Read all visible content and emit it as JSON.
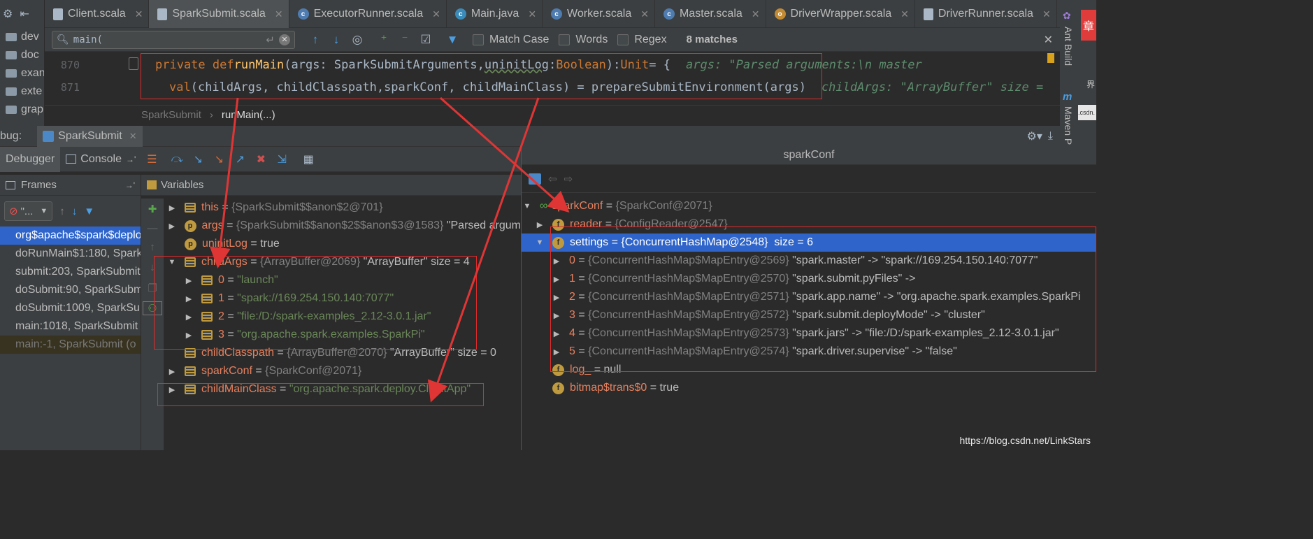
{
  "project": {
    "items": [
      {
        "label": "dev"
      },
      {
        "label": "doc"
      },
      {
        "label": "exan"
      },
      {
        "label": "exte"
      },
      {
        "label": "grap"
      }
    ]
  },
  "tabs": [
    {
      "label": "Client.scala",
      "icon": "scala-file-icon"
    },
    {
      "label": "SparkSubmit.scala",
      "icon": "scala-file-icon"
    },
    {
      "label": "ExecutorRunner.scala",
      "icon": "scala-class-icon"
    },
    {
      "label": "Main.java",
      "icon": "java-class-icon"
    },
    {
      "label": "Worker.scala",
      "icon": "scala-class-icon"
    },
    {
      "label": "Master.scala",
      "icon": "scala-class-icon"
    },
    {
      "label": "DriverWrapper.scala",
      "icon": "scala-object-icon"
    },
    {
      "label": "DriverRunner.scala",
      "icon": "scala-file-icon"
    }
  ],
  "search": {
    "value": "main(",
    "match_case": "Match Case",
    "words": "Words",
    "regex": "Regex",
    "matches": "8 matches"
  },
  "code": {
    "lines": [
      {
        "num": "870",
        "kw1": "private def ",
        "fn": "runMain",
        "p1": "(args: SparkSubmitArguments, ",
        "p2": "uninitLog",
        "p3": ": ",
        "t1": "Boolean",
        "p4": "): ",
        "t2": "Unit",
        "p5": " = {",
        "hint": "args: \"Parsed arguments:\\n  master"
      },
      {
        "num": "871",
        "kw1": "val ",
        "p1": "(childArgs, childClasspath, ",
        "p2": "sparkConf",
        "p3": ", childMainClass) = prepareSubmitEnvironment(args)",
        "hint": "childArgs: \"ArrayBuffer\" size ="
      }
    ]
  },
  "breadcrumb": {
    "root": "SparkSubmit",
    "leaf": "runMain(...)"
  },
  "debug": {
    "label": "bug:",
    "session": "SparkSubmit",
    "tabs": {
      "debugger": "Debugger",
      "console": "Console"
    }
  },
  "frames": {
    "title": "Frames",
    "thread": "\"...",
    "items": [
      "org$apache$spark$deplo",
      "doRunMain$1:180, Spark",
      "submit:203, SparkSubmit",
      "doSubmit:90, SparkSubm",
      "doSubmit:1009, SparkSu",
      "main:1018, SparkSubmit",
      "main:-1, SparkSubmit (o"
    ]
  },
  "variables": {
    "title": "Variables",
    "rows": [
      {
        "name": "this",
        "type": "{SparkSubmit$$anon$2@701}",
        "value": ""
      },
      {
        "name": "args",
        "type": "{SparkSubmit$$anon$2$$anon$3@1583}",
        "value": "\"Parsed argum"
      },
      {
        "name": "uninitLog",
        "type": "",
        "value": "true"
      },
      {
        "name": "childArgs",
        "type": "{ArrayBuffer@2069}",
        "value": "\"ArrayBuffer\" size = 4"
      },
      {
        "name": "0",
        "type": "",
        "value": "\"launch\""
      },
      {
        "name": "1",
        "type": "",
        "value": "\"spark://169.254.150.140:7077\""
      },
      {
        "name": "2",
        "type": "",
        "value": "\"file:/D:/spark-examples_2.12-3.0.1.jar\""
      },
      {
        "name": "3",
        "type": "",
        "value": "\"org.apache.spark.examples.SparkPi\""
      },
      {
        "name": "childClasspath",
        "type": "{ArrayBuffer@2070}",
        "value": "\"ArrayBuffer\" size = 0"
      },
      {
        "name": "sparkConf",
        "type": "{SparkConf@2071}",
        "value": ""
      },
      {
        "name": "childMainClass",
        "type": "",
        "value": "\"org.apache.spark.deploy.ClientApp\""
      }
    ]
  },
  "popup": {
    "title": "sparkConf",
    "rows": [
      {
        "name": "sparkConf",
        "type": "{SparkConf@2071}",
        "value": ""
      },
      {
        "name": "reader",
        "type": "{ConfigReader@2547}",
        "value": ""
      },
      {
        "name": "settings",
        "type": "{ConcurrentHashMap@2548}",
        "value": "size = 6"
      },
      {
        "name": "0",
        "type": "{ConcurrentHashMap$MapEntry@2569}",
        "value": "\"spark.master\" -> \"spark://169.254.150.140:7077\""
      },
      {
        "name": "1",
        "type": "{ConcurrentHashMap$MapEntry@2570}",
        "value": "\"spark.submit.pyFiles\" ->"
      },
      {
        "name": "2",
        "type": "{ConcurrentHashMap$MapEntry@2571}",
        "value": "\"spark.app.name\" -> \"org.apache.spark.examples.SparkPi"
      },
      {
        "name": "3",
        "type": "{ConcurrentHashMap$MapEntry@2572}",
        "value": "\"spark.submit.deployMode\" -> \"cluster\""
      },
      {
        "name": "4",
        "type": "{ConcurrentHashMap$MapEntry@2573}",
        "value": "\"spark.jars\" -> \"file:/D:/spark-examples_2.12-3.0.1.jar\""
      },
      {
        "name": "5",
        "type": "{ConcurrentHashMap$MapEntry@2574}",
        "value": "\"spark.driver.supervise\" -> \"false\""
      },
      {
        "name": "log_",
        "type": "",
        "value": "null"
      },
      {
        "name": "bitmap$trans$0",
        "type": "",
        "value": "true"
      }
    ]
  },
  "right_rail": {
    "ant": "Ant Build",
    "maven": "Maven P",
    "corner": "章",
    "side1": "界",
    "side2": ".csdn."
  },
  "watermark": "https://blog.csdn.net/LinkStars",
  "colors": {
    "annotation": "#e02b2b",
    "selection": "#2f65ca",
    "accent": "#4a9ee3"
  }
}
